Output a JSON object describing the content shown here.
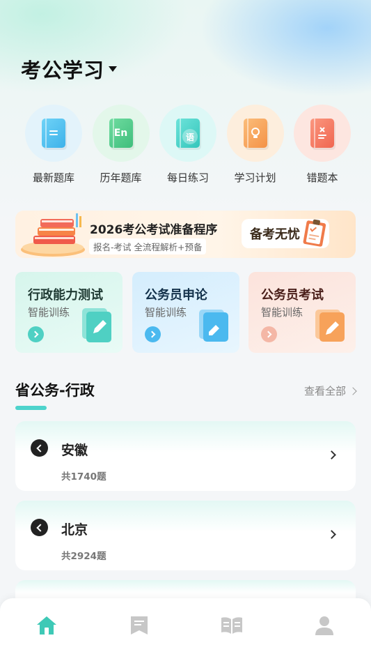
{
  "header": {
    "title": "考公学习"
  },
  "quick_actions": [
    {
      "label": "最新题库",
      "icon": "question-bank-icon",
      "bg": "#e3f3fb",
      "color": "#4fc1ef"
    },
    {
      "label": "历年题库",
      "icon": "english-book-icon",
      "bg": "#e3f7ea",
      "book_text": "En",
      "color": "#52c98a"
    },
    {
      "label": "每日练习",
      "icon": "language-book-icon",
      "bg": "#ddf8f6",
      "book_text": "语",
      "color": "#42d2c8"
    },
    {
      "label": "学习计划",
      "icon": "idea-book-icon",
      "bg": "#fdeedd",
      "color": "#f9a55a"
    },
    {
      "label": "错题本",
      "icon": "wrong-notebook-icon",
      "bg": "#fde6e0",
      "color": "#f57c68"
    }
  ],
  "banner": {
    "title": "2026考公考试准备程序",
    "subtitle": "报名-考试 全流程解析+预备",
    "badge": "备考无忧"
  },
  "cards": [
    {
      "title": "行政能力测试",
      "subtitle": "智能训练",
      "bg": "#dcf7ef",
      "accent": "#4fd0c3",
      "title_color": "#1f3a33"
    },
    {
      "title": "公务员申论",
      "subtitle": "智能训练",
      "bg": "#dcf0fc",
      "accent": "#4bb9ef",
      "title_color": "#13314a"
    },
    {
      "title": "公务员考试",
      "subtitle": "智能训练",
      "bg": "#fde8e1",
      "accent": "#f7a25a",
      "title_color": "#4a1f1a"
    }
  ],
  "section": {
    "title": "省公务-行政",
    "view_all": "查看全部"
  },
  "list": [
    {
      "name": "安徽",
      "count": "共1740题"
    },
    {
      "name": "北京",
      "count": "共2924题"
    }
  ],
  "bottom_nav": [
    {
      "icon": "home-icon",
      "active": true
    },
    {
      "icon": "bookmark-icon",
      "active": false
    },
    {
      "icon": "open-book-icon",
      "active": false
    },
    {
      "icon": "user-icon",
      "active": false
    }
  ],
  "colors": {
    "accent": "#4dd3cc",
    "nav_active": "#3ec9b6",
    "nav_inactive": "#c7c7c7"
  }
}
